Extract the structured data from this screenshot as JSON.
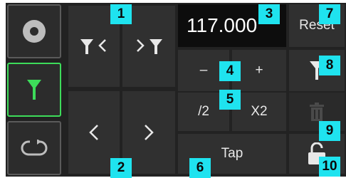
{
  "bpm": {
    "value": "117.000"
  },
  "buttons": {
    "reset": "Reset",
    "minus": "–",
    "plus": "+",
    "half": "/2",
    "double": "X2",
    "tap": "Tap"
  },
  "badges": [
    "1",
    "2",
    "3",
    "4",
    "5",
    "6",
    "7",
    "8",
    "9",
    "10"
  ],
  "colors": {
    "accent_green": "#3ddc5a",
    "badge_cyan": "#1fe3ef"
  },
  "sidebar": {
    "items": [
      {
        "icon": "disc-icon",
        "active": false
      },
      {
        "icon": "beatgrid-marker-icon",
        "active": true
      },
      {
        "icon": "loop-icon",
        "active": false
      }
    ]
  }
}
